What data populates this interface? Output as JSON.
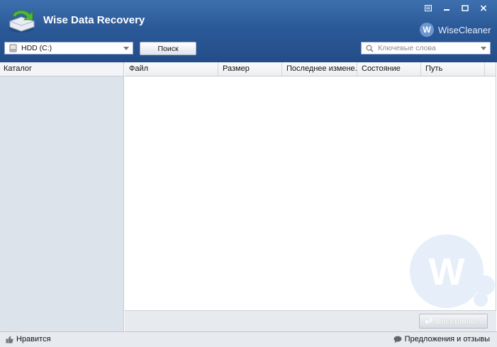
{
  "app": {
    "title": "Wise Data Recovery",
    "brand": "WiseCleaner",
    "brand_initial": "W"
  },
  "toolbar": {
    "drive": {
      "selected": "HDD (C:)"
    },
    "search_button": "Поиск",
    "keyword_search": {
      "placeholder": "Ключевые слова",
      "value": ""
    }
  },
  "sidebar": {
    "header": "Каталог"
  },
  "table": {
    "columns": [
      "Файл",
      "Размер",
      "Последнее измене...",
      "Состояние",
      "Путь"
    ],
    "rows": []
  },
  "actions": {
    "restore_button": "Восстанов..."
  },
  "statusbar": {
    "like": "Нравится",
    "feedback": "Предложения и отзывы"
  },
  "watermark_letter": "W",
  "colors": {
    "header": "#2b5998",
    "sidebar": "#dde3eb",
    "brand_circle": "#6d97cf"
  }
}
